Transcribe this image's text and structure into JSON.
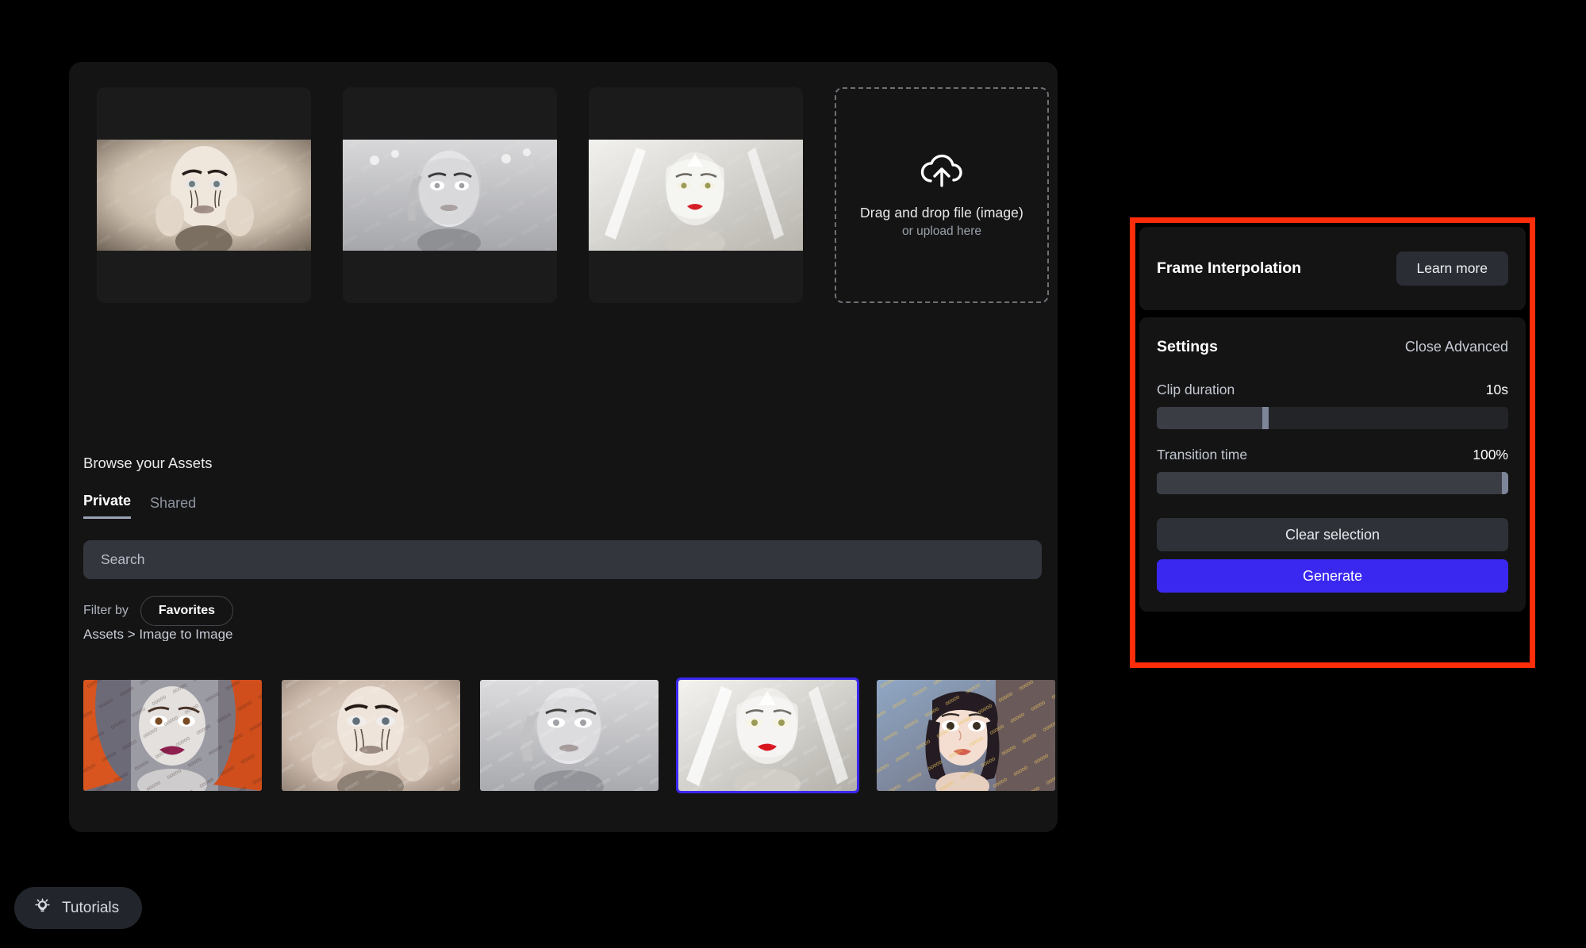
{
  "workspace": {
    "frames": [
      {
        "name": "frame-slot-1",
        "alt": "pale gothic portrait with dark eye makeup, hands to face"
      },
      {
        "name": "frame-slot-2",
        "alt": "silver armored woman with braided hair"
      },
      {
        "name": "frame-slot-3",
        "alt": "white crystalline fairy with red lips"
      }
    ],
    "dropzone": {
      "icon": "cloud-upload-icon",
      "title": "Drag and drop file (image)",
      "subtitle": "or upload here"
    },
    "browse": {
      "heading": "Browse your Assets",
      "tabs": [
        {
          "label": "Private",
          "active": true
        },
        {
          "label": "Shared",
          "active": false
        }
      ],
      "search_placeholder": "Search",
      "filter_label": "Filter by",
      "filter_chip": "Favorites",
      "breadcrumb": "Assets > Image to Image",
      "thumbnails": [
        {
          "alt": "red haired woman with magenta lips",
          "selected": false
        },
        {
          "alt": "sepia gothic portrait with dark eyes",
          "selected": false
        },
        {
          "alt": "grey armored woman with braid",
          "selected": false
        },
        {
          "alt": "white crystalline fairy with red lips",
          "selected": true
        },
        {
          "alt": "anime style woman with gold accents",
          "selected": false
        }
      ]
    }
  },
  "panel": {
    "title": "Frame Interpolation",
    "learn_more": "Learn more",
    "settings_title": "Settings",
    "advanced_toggle": "Close Advanced",
    "sliders": [
      {
        "label": "Clip duration",
        "value": "10s",
        "fill_percent": 31,
        "knob_percent": 31
      },
      {
        "label": "Transition time",
        "value": "100%",
        "fill_percent": 100,
        "knob_percent": 100
      }
    ],
    "clear_button": "Clear selection",
    "generate_button": "Generate"
  },
  "footer": {
    "tutorials_label": "Tutorials",
    "tutorials_icon": "lightbulb-icon"
  },
  "colors": {
    "accent_blue": "#3b28f0",
    "annotation_red": "#ff2d0a",
    "card_bg": "#141414",
    "input_bg": "#33363d"
  }
}
